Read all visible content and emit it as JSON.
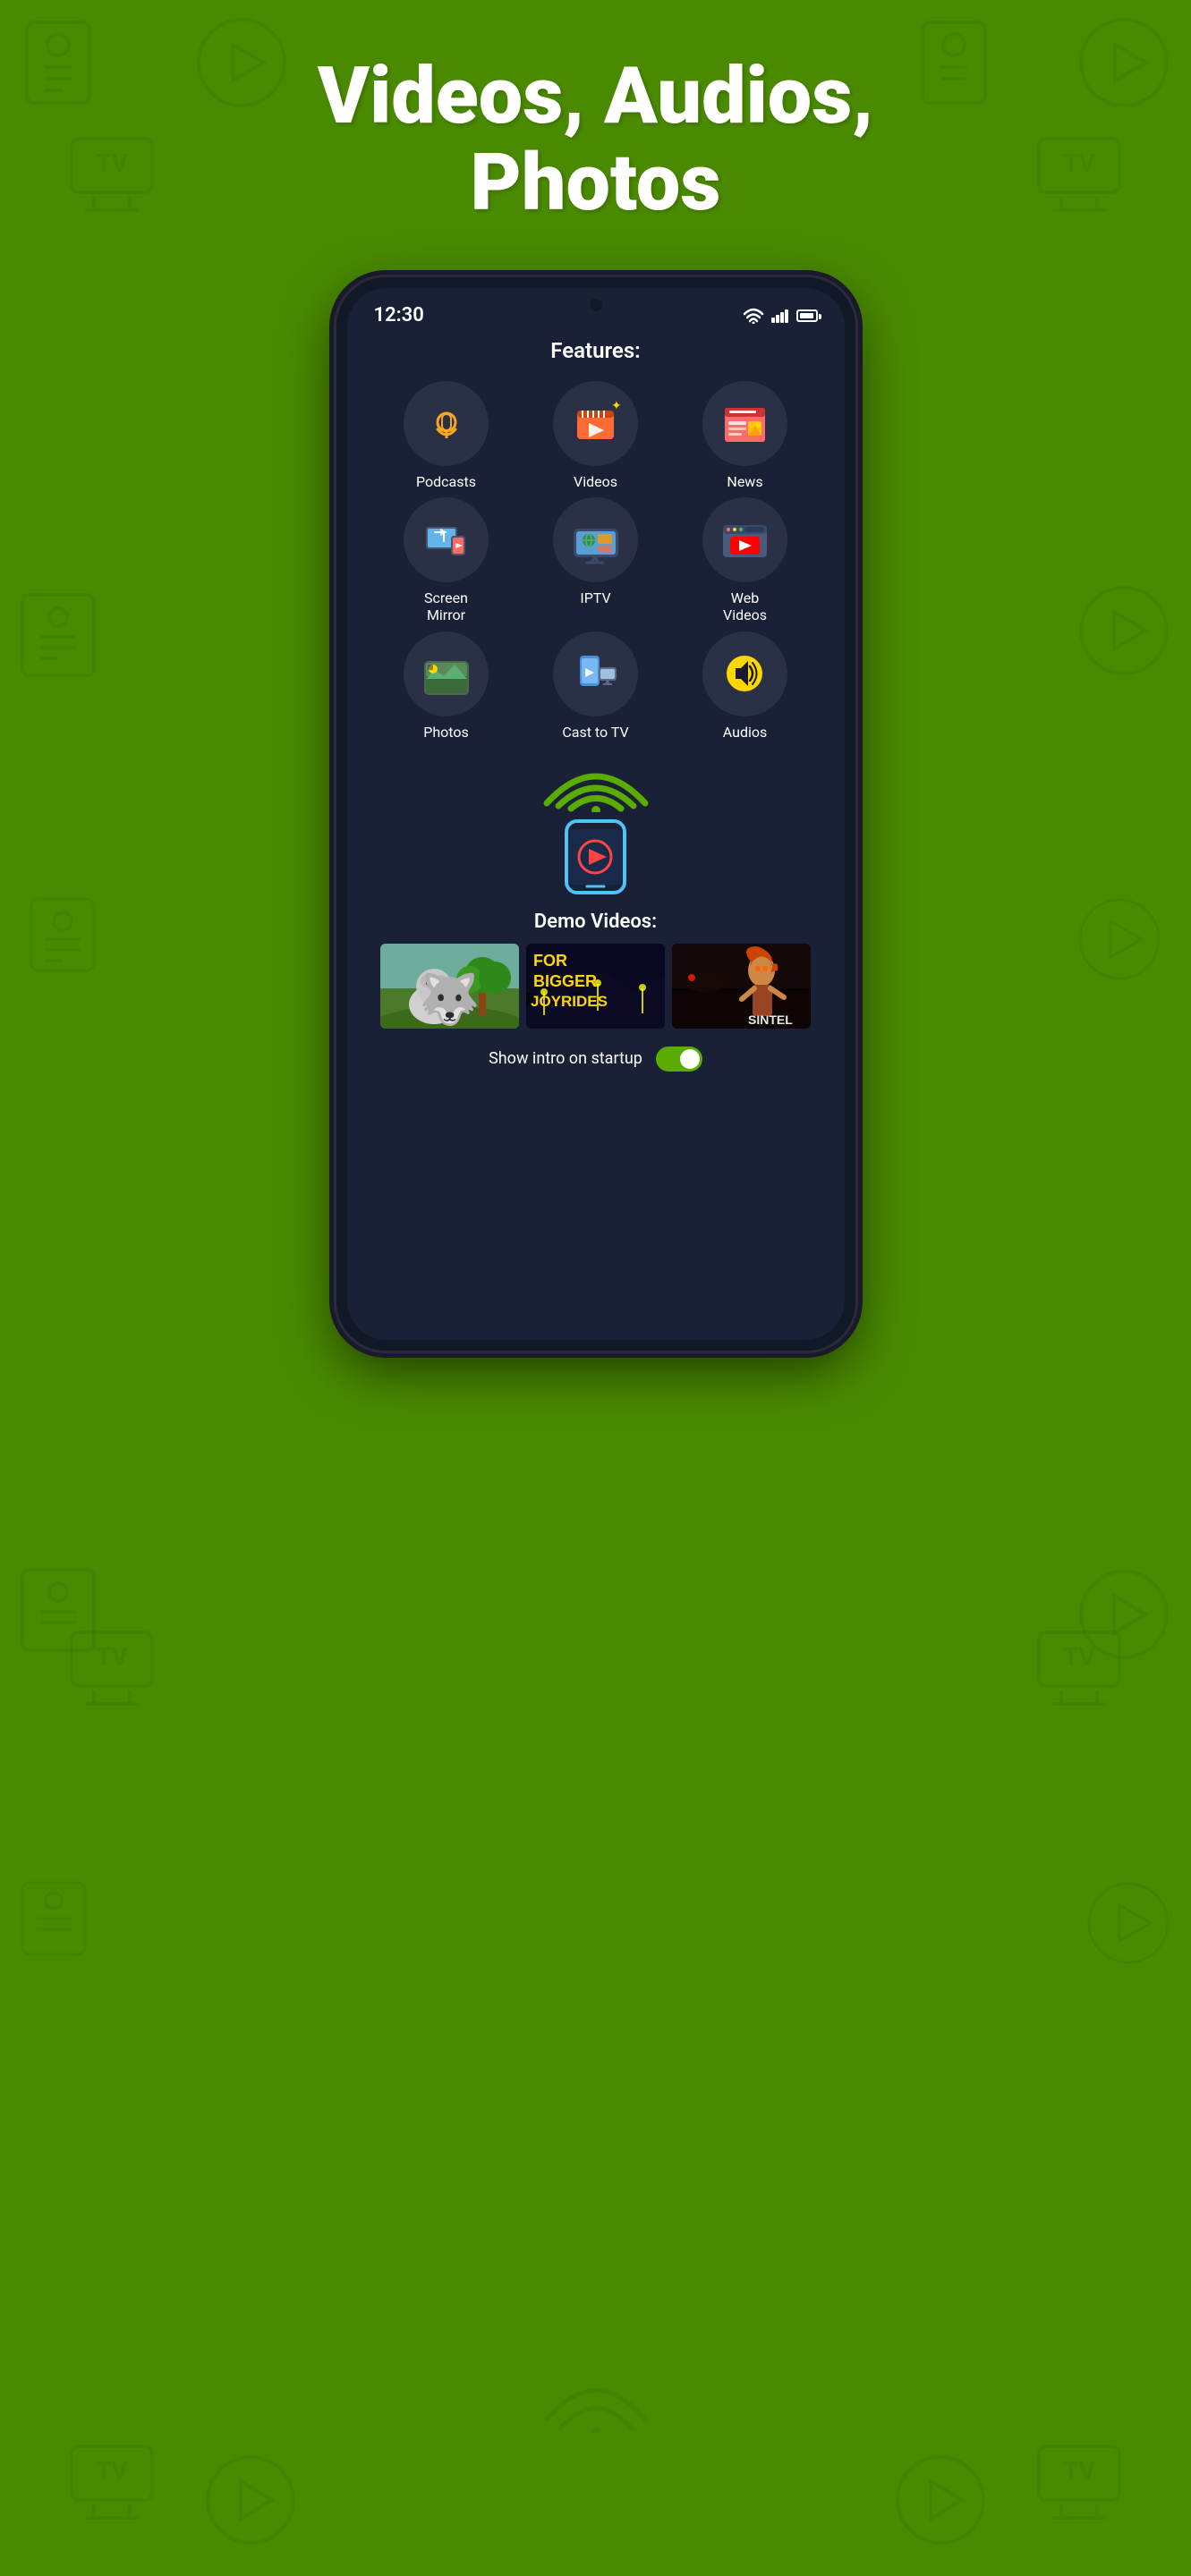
{
  "background": {
    "color": "#4a8a00"
  },
  "header": {
    "title": "Videos, Audios,\nPhotos",
    "title_line1": "Videos, Audios,",
    "title_line2": "Photos"
  },
  "phone": {
    "status_bar": {
      "time": "12:30",
      "wifi": true,
      "signal": true,
      "battery": true
    },
    "features_label": "Features:",
    "features": [
      {
        "id": "podcasts",
        "label": "Podcasts",
        "icon": "podcast"
      },
      {
        "id": "videos",
        "label": "Videos",
        "icon": "video"
      },
      {
        "id": "news",
        "label": "News",
        "icon": "news"
      },
      {
        "id": "screen-mirror",
        "label": "Screen\nMirror",
        "icon": "mirror"
      },
      {
        "id": "iptv",
        "label": "IPTV",
        "icon": "iptv"
      },
      {
        "id": "web-videos",
        "label": "Web\nVideos",
        "icon": "web"
      },
      {
        "id": "photos",
        "label": "Photos",
        "icon": "photos"
      },
      {
        "id": "cast-to-tv",
        "label": "Cast to TV",
        "icon": "cast"
      },
      {
        "id": "audios",
        "label": "Audios",
        "icon": "audio"
      }
    ],
    "demo_label": "Demo Videos:",
    "demo_videos": [
      {
        "id": "video1",
        "type": "animal"
      },
      {
        "id": "video2",
        "type": "joyrides",
        "text": "FOR\nBIGGER\nJOYRIDES"
      },
      {
        "id": "video3",
        "type": "sintel",
        "text": "SINTEL"
      }
    ],
    "toggle": {
      "label": "Show intro on startup",
      "value": true
    }
  }
}
